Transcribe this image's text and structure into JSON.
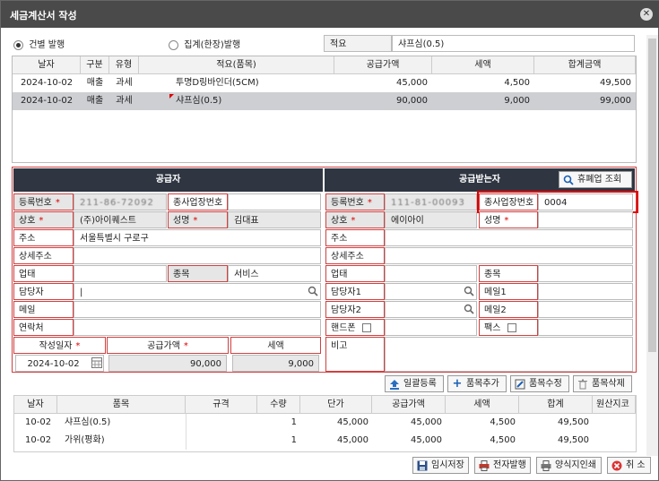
{
  "window": {
    "title": "세금계산서 작성"
  },
  "top": {
    "radio_individual": "건별 발행",
    "radio_summary": "집계(한장)발행",
    "summary_label": "적요",
    "summary_value": "샤프심(0.5)"
  },
  "list": {
    "headers": [
      "날자",
      "구분",
      "유형",
      "적요(품목)",
      "공급가액",
      "세액",
      "합계금액"
    ],
    "rows": [
      [
        "2024-10-02",
        "매출",
        "과세",
        "투명D링바인더(5CM)",
        "45,000",
        "4,500",
        "49,500"
      ],
      [
        "2024-10-02",
        "매출",
        "과세",
        "샤프심(0.5)",
        "90,000",
        "9,000",
        "99,000"
      ]
    ]
  },
  "supplier": {
    "title": "공급자",
    "reg_label": "등록번호",
    "reg_value": "211-86-72092",
    "branch_label": "종사업장번호",
    "name_label": "상호",
    "name_value": "(주)아이퀘스트",
    "ceo_label": "성명",
    "ceo_value": "김대표",
    "addr_label": "주소",
    "addr_value": "서울특별시 구로구",
    "addr2_label": "상세주소",
    "biz_label": "업태",
    "item_label": "종목",
    "item_value": "서비스",
    "manager_label": "담당자",
    "manager_value": "|",
    "mail_label": "메일",
    "contact_label": "연락처",
    "date_label": "작성일자",
    "date_value": "2024-10-02",
    "amount_label": "공급가액",
    "amount_value": "90,000",
    "tax_label": "세액",
    "tax_value": "9,000"
  },
  "buyer": {
    "title": "공급받는자",
    "closure_button": "휴폐업 조회",
    "reg_label": "등록번호",
    "reg_value": "111-81-00093",
    "branch_label": "종사업장번호",
    "branch_value": "0004",
    "name_label": "상호",
    "name_value": "에이아이",
    "ceo_label": "성명",
    "addr_label": "주소",
    "addr2_label": "상세주소",
    "biz_label": "업태",
    "item_label": "종목",
    "manager1_label": "담당자1",
    "mail1_label": "메일1",
    "manager2_label": "담당자2",
    "mail2_label": "메일2",
    "phone_label": "핸드폰",
    "fax_label": "팩스",
    "note_label": "비고"
  },
  "item_toolbar": {
    "bulk": "일괄등록",
    "add": "품목추가",
    "edit": "품목수정",
    "delete": "품목삭제"
  },
  "items": {
    "headers": [
      "날자",
      "품목",
      "규격",
      "수량",
      "단가",
      "공급가액",
      "세액",
      "합계",
      "원산지코"
    ],
    "rows": [
      [
        "10-02",
        "샤프심(0.5)",
        "",
        "1",
        "45,000",
        "45,000",
        "4,500",
        "49,500",
        ""
      ],
      [
        "10-02",
        "가위(평화)",
        "",
        "1",
        "45,000",
        "45,000",
        "4,500",
        "49,500",
        ""
      ]
    ]
  },
  "footer": {
    "save_temp": "임시저장",
    "e_issue": "전자발행",
    "print": "양식지인쇄",
    "cancel": "취 소"
  },
  "colors": {
    "header_dark": "#2f3642",
    "required_red": "#d04040",
    "highlight_red": "#e00000"
  }
}
